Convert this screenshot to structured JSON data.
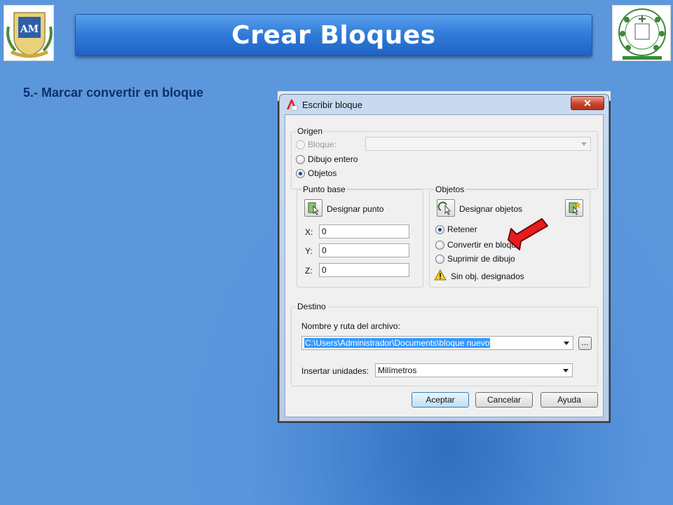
{
  "slide": {
    "title": "Crear Bloques",
    "step": "5.- Marcar convertir en bloque"
  },
  "dialog": {
    "title": "Escribir bloque",
    "close_label": "✕",
    "origen": {
      "label": "Origen",
      "bloque_label": "Bloque:",
      "dibujo_label": "Dibujo entero",
      "objetos_label": "Objetos",
      "selected": "Objetos"
    },
    "punto_base": {
      "label": "Punto base",
      "designar_label": "Designar punto",
      "x_label": "X:",
      "x_value": "0",
      "y_label": "Y:",
      "y_value": "0",
      "z_label": "Z:",
      "z_value": "0"
    },
    "objetos": {
      "label": "Objetos",
      "designar_label": "Designar objetos",
      "retener_label": "Retener",
      "convertir_label": "Convertir en bloque",
      "suprimir_label": "Suprimir de dibujo",
      "selected": "Retener",
      "warning": "Sin obj. designados"
    },
    "destino": {
      "label": "Destino",
      "nombre_label": "Nombre y ruta del archivo:",
      "path_value": "C:\\Users\\Administrador\\Documents\\bloque nuevo",
      "browse_label": "...",
      "unidades_label": "Insertar unidades:",
      "unidades_value": "Milímetros"
    },
    "buttons": {
      "aceptar": "Aceptar",
      "cancelar": "Cancelar",
      "ayuda": "Ayuda"
    }
  },
  "colors": {
    "slide_bg": "#5c97dc",
    "title_bar": "#2f7ad8",
    "callout_arrow": "#e81c1c"
  }
}
